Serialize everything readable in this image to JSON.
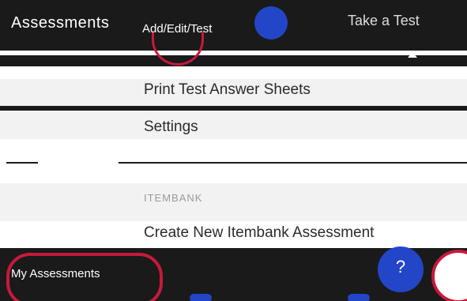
{
  "header": {
    "title": "Assessments",
    "subtitle": "Add/Edit/Test",
    "right_text": "Take a Test"
  },
  "menu": {
    "print_label": "Print Test Answer Sheets",
    "settings_label": "Settings"
  },
  "itembank": {
    "section_label": "ITEMBANK",
    "create_label": "Create New Itembank Assessment"
  },
  "bottom_bar": {
    "label": "My Assessments",
    "help_label": "?"
  },
  "colors": {
    "band": "#1a1a1a",
    "accent_blue": "#2346c8",
    "accent_red": "#c7193c",
    "section_label": "#9a9a9a"
  }
}
